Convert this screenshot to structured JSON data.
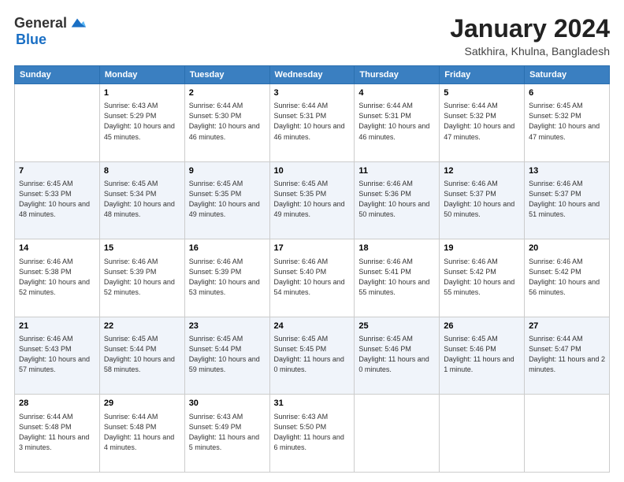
{
  "header": {
    "logo_general": "General",
    "logo_blue": "Blue",
    "month_title": "January 2024",
    "location": "Satkhira, Khulna, Bangladesh"
  },
  "days_of_week": [
    "Sunday",
    "Monday",
    "Tuesday",
    "Wednesday",
    "Thursday",
    "Friday",
    "Saturday"
  ],
  "weeks": [
    [
      {
        "day": "",
        "sunrise": "",
        "sunset": "",
        "daylight": ""
      },
      {
        "day": "1",
        "sunrise": "Sunrise: 6:43 AM",
        "sunset": "Sunset: 5:29 PM",
        "daylight": "Daylight: 10 hours and 45 minutes."
      },
      {
        "day": "2",
        "sunrise": "Sunrise: 6:44 AM",
        "sunset": "Sunset: 5:30 PM",
        "daylight": "Daylight: 10 hours and 46 minutes."
      },
      {
        "day": "3",
        "sunrise": "Sunrise: 6:44 AM",
        "sunset": "Sunset: 5:31 PM",
        "daylight": "Daylight: 10 hours and 46 minutes."
      },
      {
        "day": "4",
        "sunrise": "Sunrise: 6:44 AM",
        "sunset": "Sunset: 5:31 PM",
        "daylight": "Daylight: 10 hours and 46 minutes."
      },
      {
        "day": "5",
        "sunrise": "Sunrise: 6:44 AM",
        "sunset": "Sunset: 5:32 PM",
        "daylight": "Daylight: 10 hours and 47 minutes."
      },
      {
        "day": "6",
        "sunrise": "Sunrise: 6:45 AM",
        "sunset": "Sunset: 5:32 PM",
        "daylight": "Daylight: 10 hours and 47 minutes."
      }
    ],
    [
      {
        "day": "7",
        "sunrise": "Sunrise: 6:45 AM",
        "sunset": "Sunset: 5:33 PM",
        "daylight": "Daylight: 10 hours and 48 minutes."
      },
      {
        "day": "8",
        "sunrise": "Sunrise: 6:45 AM",
        "sunset": "Sunset: 5:34 PM",
        "daylight": "Daylight: 10 hours and 48 minutes."
      },
      {
        "day": "9",
        "sunrise": "Sunrise: 6:45 AM",
        "sunset": "Sunset: 5:35 PM",
        "daylight": "Daylight: 10 hours and 49 minutes."
      },
      {
        "day": "10",
        "sunrise": "Sunrise: 6:45 AM",
        "sunset": "Sunset: 5:35 PM",
        "daylight": "Daylight: 10 hours and 49 minutes."
      },
      {
        "day": "11",
        "sunrise": "Sunrise: 6:46 AM",
        "sunset": "Sunset: 5:36 PM",
        "daylight": "Daylight: 10 hours and 50 minutes."
      },
      {
        "day": "12",
        "sunrise": "Sunrise: 6:46 AM",
        "sunset": "Sunset: 5:37 PM",
        "daylight": "Daylight: 10 hours and 50 minutes."
      },
      {
        "day": "13",
        "sunrise": "Sunrise: 6:46 AM",
        "sunset": "Sunset: 5:37 PM",
        "daylight": "Daylight: 10 hours and 51 minutes."
      }
    ],
    [
      {
        "day": "14",
        "sunrise": "Sunrise: 6:46 AM",
        "sunset": "Sunset: 5:38 PM",
        "daylight": "Daylight: 10 hours and 52 minutes."
      },
      {
        "day": "15",
        "sunrise": "Sunrise: 6:46 AM",
        "sunset": "Sunset: 5:39 PM",
        "daylight": "Daylight: 10 hours and 52 minutes."
      },
      {
        "day": "16",
        "sunrise": "Sunrise: 6:46 AM",
        "sunset": "Sunset: 5:39 PM",
        "daylight": "Daylight: 10 hours and 53 minutes."
      },
      {
        "day": "17",
        "sunrise": "Sunrise: 6:46 AM",
        "sunset": "Sunset: 5:40 PM",
        "daylight": "Daylight: 10 hours and 54 minutes."
      },
      {
        "day": "18",
        "sunrise": "Sunrise: 6:46 AM",
        "sunset": "Sunset: 5:41 PM",
        "daylight": "Daylight: 10 hours and 55 minutes."
      },
      {
        "day": "19",
        "sunrise": "Sunrise: 6:46 AM",
        "sunset": "Sunset: 5:42 PM",
        "daylight": "Daylight: 10 hours and 55 minutes."
      },
      {
        "day": "20",
        "sunrise": "Sunrise: 6:46 AM",
        "sunset": "Sunset: 5:42 PM",
        "daylight": "Daylight: 10 hours and 56 minutes."
      }
    ],
    [
      {
        "day": "21",
        "sunrise": "Sunrise: 6:46 AM",
        "sunset": "Sunset: 5:43 PM",
        "daylight": "Daylight: 10 hours and 57 minutes."
      },
      {
        "day": "22",
        "sunrise": "Sunrise: 6:45 AM",
        "sunset": "Sunset: 5:44 PM",
        "daylight": "Daylight: 10 hours and 58 minutes."
      },
      {
        "day": "23",
        "sunrise": "Sunrise: 6:45 AM",
        "sunset": "Sunset: 5:44 PM",
        "daylight": "Daylight: 10 hours and 59 minutes."
      },
      {
        "day": "24",
        "sunrise": "Sunrise: 6:45 AM",
        "sunset": "Sunset: 5:45 PM",
        "daylight": "Daylight: 11 hours and 0 minutes."
      },
      {
        "day": "25",
        "sunrise": "Sunrise: 6:45 AM",
        "sunset": "Sunset: 5:46 PM",
        "daylight": "Daylight: 11 hours and 0 minutes."
      },
      {
        "day": "26",
        "sunrise": "Sunrise: 6:45 AM",
        "sunset": "Sunset: 5:46 PM",
        "daylight": "Daylight: 11 hours and 1 minute."
      },
      {
        "day": "27",
        "sunrise": "Sunrise: 6:44 AM",
        "sunset": "Sunset: 5:47 PM",
        "daylight": "Daylight: 11 hours and 2 minutes."
      }
    ],
    [
      {
        "day": "28",
        "sunrise": "Sunrise: 6:44 AM",
        "sunset": "Sunset: 5:48 PM",
        "daylight": "Daylight: 11 hours and 3 minutes."
      },
      {
        "day": "29",
        "sunrise": "Sunrise: 6:44 AM",
        "sunset": "Sunset: 5:48 PM",
        "daylight": "Daylight: 11 hours and 4 minutes."
      },
      {
        "day": "30",
        "sunrise": "Sunrise: 6:43 AM",
        "sunset": "Sunset: 5:49 PM",
        "daylight": "Daylight: 11 hours and 5 minutes."
      },
      {
        "day": "31",
        "sunrise": "Sunrise: 6:43 AM",
        "sunset": "Sunset: 5:50 PM",
        "daylight": "Daylight: 11 hours and 6 minutes."
      },
      {
        "day": "",
        "sunrise": "",
        "sunset": "",
        "daylight": ""
      },
      {
        "day": "",
        "sunrise": "",
        "sunset": "",
        "daylight": ""
      },
      {
        "day": "",
        "sunrise": "",
        "sunset": "",
        "daylight": ""
      }
    ]
  ]
}
